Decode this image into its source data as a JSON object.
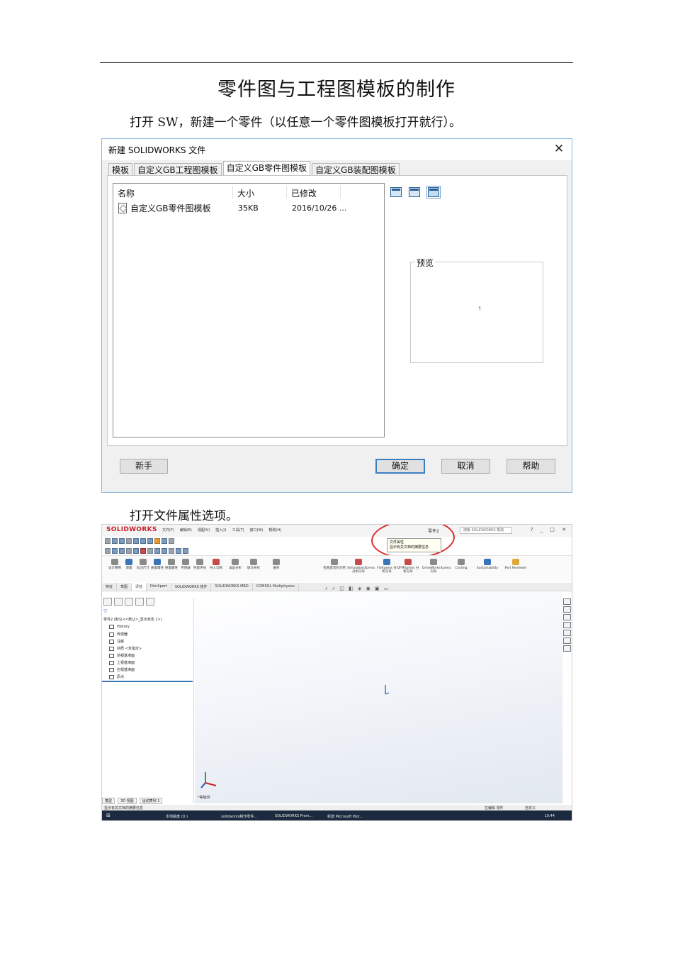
{
  "doc": {
    "title": "零件图与工程图模板的制作",
    "para1": "打开 SW，新建一个零件（以任意一个零件图模板打开就行）。",
    "para2": "打开文件属性选项。"
  },
  "dialog": {
    "title": "新建 SOLIDWORKS 文件",
    "close_glyph": "✕",
    "tabs": [
      {
        "label": "模板"
      },
      {
        "label": "自定义GB工程图模板"
      },
      {
        "label": "自定义GB零件图模板"
      },
      {
        "label": "自定义GB装配图模板"
      }
    ],
    "columns": {
      "name": "名称",
      "size": "大小",
      "modified": "已修改"
    },
    "file": {
      "name": "自定义GB零件图模板",
      "size": "35KB",
      "modified": "2016/10/26 ..."
    },
    "preview_label": "预览",
    "buttons": {
      "novice": "新手",
      "ok": "确定",
      "cancel": "取消",
      "help": "帮助"
    }
  },
  "sw": {
    "logo": "SOLIDWORKS",
    "menu": [
      "文件(F)",
      "编辑(E)",
      "视图(V)",
      "插入(I)",
      "工具(T)",
      "窗口(W)",
      "帮助(H)"
    ],
    "part_name": "零件2",
    "search": "搜索 SOLIDWORKS 帮助",
    "tooltip": {
      "title": "文件属性",
      "desc": "显示有关文档的摘要信息"
    },
    "ribbon": [
      {
        "label": "设计算例"
      },
      {
        "label": "测量"
      },
      {
        "label": "标注尺寸"
      },
      {
        "label": "质量属性"
      },
      {
        "label": "剖面属性"
      },
      {
        "label": "传感器"
      },
      {
        "label": "性能评估"
      },
      {
        "label": "导入诊断"
      },
      {
        "label": "误差分析"
      },
      {
        "label": "斑马条纹"
      },
      {
        "label": "曲率"
      },
      {
        "label": "检查激活的文档"
      },
      {
        "label": "SimulationXpress 分析向导"
      },
      {
        "label": "FloXpress 分析向导"
      },
      {
        "label": "DFMXpress 分析向导"
      },
      {
        "label": "DriveWorksXpress 向导"
      },
      {
        "label": "Costing"
      },
      {
        "label": "Sustainability"
      },
      {
        "label": "Part Reviewer"
      }
    ],
    "tabs": [
      "特征",
      "草图",
      "评估",
      "DimXpert",
      "SOLIDWORKS 插件",
      "SOLIDWORKS MBD",
      "COMSOL Multiphysics"
    ],
    "tree_root": "零件2 (默认<<默认>_显示状态 1>)",
    "tree_items": [
      "History",
      "传感器",
      "注解",
      "材质 <未指定>",
      "前视基准面",
      "上视基准面",
      "右视基准面",
      "原点"
    ],
    "view_label": "*等轴测",
    "bottom_tabs": [
      "模型",
      "3D 视图",
      "运动算例 1"
    ],
    "status_left": "显示有关文档的摘要信息",
    "status_right": "在编辑 零件",
    "status_right2": "自定义",
    "taskbar": [
      "本地磁盘 (D:)",
      "solidworks制作零件...",
      "SOLIDWORKS Prem...",
      "新建 Microsoft Wor..."
    ],
    "clock": "10:44"
  }
}
